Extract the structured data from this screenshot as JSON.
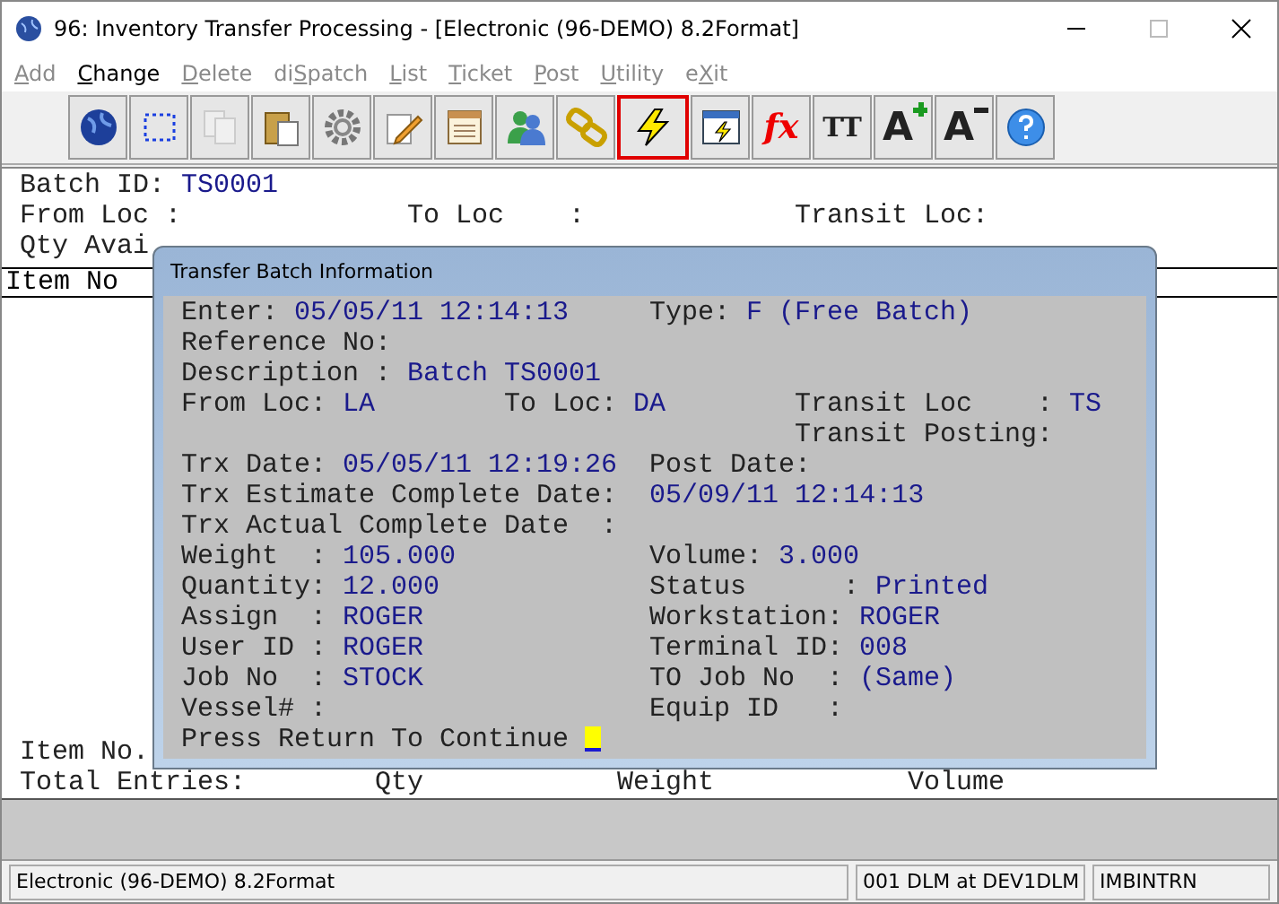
{
  "window": {
    "title": "96: Inventory Transfer Processing - [Electronic (96-DEMO) 8.2Format]"
  },
  "menu": [
    {
      "key": "A",
      "after": "dd",
      "disabled": true
    },
    {
      "key": "C",
      "after": "hange",
      "disabled": false
    },
    {
      "key": "D",
      "after": "elete",
      "disabled": true
    },
    {
      "before": "di",
      "key": "S",
      "after": "patch",
      "disabled": true
    },
    {
      "key": "L",
      "after": "ist",
      "disabled": true
    },
    {
      "key": "T",
      "after": "icket",
      "disabled": true
    },
    {
      "key": "P",
      "after": "ost",
      "disabled": true
    },
    {
      "key": "U",
      "after": "tility",
      "disabled": true
    },
    {
      "before": "e",
      "key": "X",
      "after": "it",
      "disabled": true
    }
  ],
  "toolbar": [
    {
      "kind": "globe",
      "selected": false,
      "disabled": false
    },
    {
      "kind": "select",
      "selected": false,
      "disabled": false
    },
    {
      "kind": "copy",
      "selected": false,
      "disabled": true
    },
    {
      "kind": "paste",
      "selected": false,
      "disabled": false
    },
    {
      "kind": "gear",
      "selected": false,
      "disabled": false
    },
    {
      "kind": "pencil",
      "selected": false,
      "disabled": false
    },
    {
      "kind": "form",
      "selected": false,
      "disabled": false
    },
    {
      "kind": "users",
      "selected": false,
      "disabled": false
    },
    {
      "kind": "chain",
      "selected": false,
      "disabled": false
    },
    {
      "kind": "bolt",
      "selected": true,
      "disabled": false
    },
    {
      "kind": "window-bolt",
      "selected": false,
      "disabled": false
    },
    {
      "kind": "fx",
      "text": "fx",
      "selected": false,
      "disabled": false
    },
    {
      "kind": "tt",
      "text": "TT",
      "selected": false,
      "disabled": false
    },
    {
      "kind": "font-up",
      "text": "A",
      "selected": false,
      "disabled": false
    },
    {
      "kind": "font-down",
      "text": "A",
      "selected": false,
      "disabled": false
    },
    {
      "kind": "help",
      "selected": false,
      "disabled": false
    }
  ],
  "screen": {
    "batch_label": "Batch ID:",
    "batch_value": "TS0001",
    "loc_row": [
      "From Loc :",
      "To Loc    :",
      "Transit Loc:"
    ],
    "qty_label": "Qty Avai",
    "header": "Item No",
    "footer_item": "Item No.",
    "totals": [
      "Total Entries:",
      "Qty",
      "Weight",
      "Volume"
    ]
  },
  "dialog": {
    "title": "Transfer Batch Information",
    "rows": [
      {
        "left": {
          "label": "Enter:",
          "value": "05/05/11 12:14:13"
        },
        "right": {
          "label": "Type:",
          "value": "F (Free Batch)"
        }
      },
      {
        "left": {
          "label": "Reference No:"
        }
      },
      {
        "left": {
          "label": "Description :",
          "value": "Batch TS0001"
        }
      },
      {
        "left": {
          "label": "From Loc:",
          "value": "LA"
        },
        "middle": {
          "label": "To Loc:",
          "value": "DA"
        },
        "far": {
          "label": "Transit Loc    :",
          "value": "TS"
        }
      },
      {
        "far": {
          "label": "Transit Posting:"
        }
      },
      {
        "left": {
          "label": "Trx Date:",
          "value": "05/05/11 12:19:26"
        },
        "right": {
          "label": "Post Date:"
        }
      },
      {
        "left": {
          "label": "Trx Estimate Complete Date: ",
          "value": "05/09/11 12:14:13"
        }
      },
      {
        "left": {
          "label": "Trx Actual Complete Date  :"
        }
      },
      {
        "left": {
          "label": "Weight  :",
          "value": "105.000"
        },
        "right": {
          "label": "Volume:",
          "value": "3.000"
        }
      },
      {
        "left": {
          "label": "Quantity:",
          "value": "12.000"
        },
        "right": {
          "label": "Status      :",
          "value": "Printed"
        }
      },
      {
        "left": {
          "label": "Assign  :",
          "value": "ROGER"
        },
        "right": {
          "label": "Workstation:",
          "value": "ROGER"
        }
      },
      {
        "left": {
          "label": "User ID :",
          "value": "ROGER"
        },
        "right": {
          "label": "Terminal ID:",
          "value": "008"
        }
      },
      {
        "left": {
          "label": "Job No  :",
          "value": "STOCK"
        },
        "right": {
          "label": "TO Job No  :",
          "value": "(Same)"
        }
      },
      {
        "left": {
          "label": "Vessel# :"
        },
        "right": {
          "label": "Equip ID   :"
        }
      }
    ],
    "prompt": "Press Return To Continue"
  },
  "status_bar": [
    "Electronic (96-DEMO) 8.2Format",
    "001 DLM at DEV1DLM",
    "IMBINTRN"
  ]
}
